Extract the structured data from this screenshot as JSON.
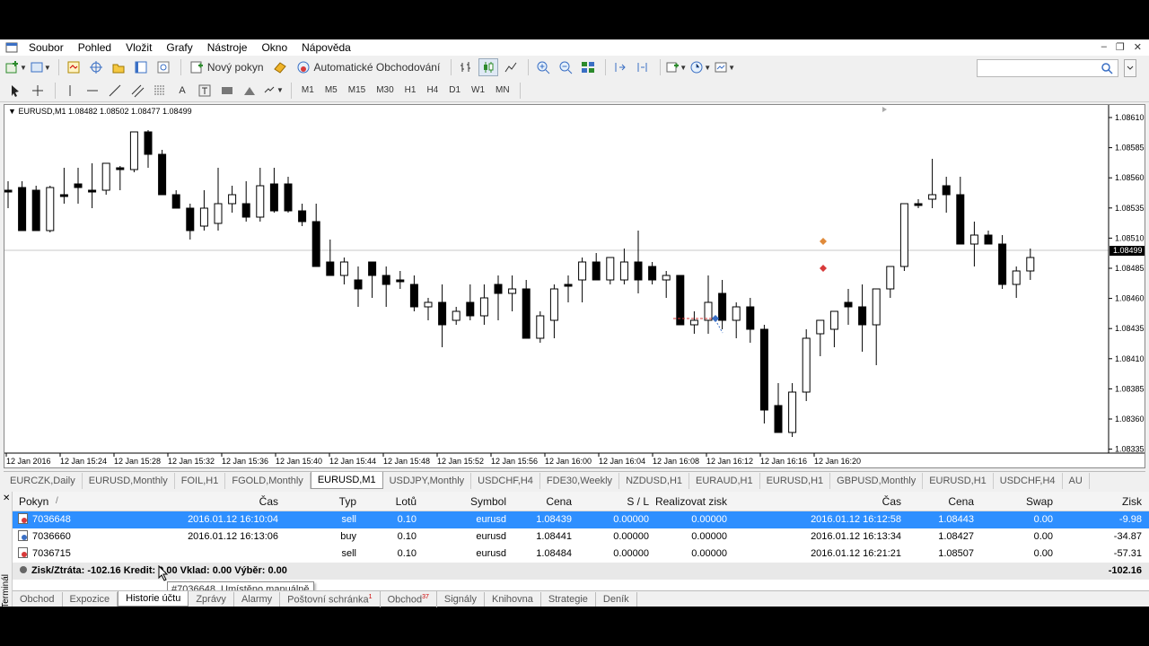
{
  "menu": [
    "Soubor",
    "Pohled",
    "Vložit",
    "Grafy",
    "Nástroje",
    "Okno",
    "Nápověda"
  ],
  "toolbar": {
    "new_order": "Nový pokyn",
    "auto_trading": "Automatické Obchodování"
  },
  "timeframes": [
    "M1",
    "M5",
    "M15",
    "M30",
    "H1",
    "H4",
    "D1",
    "W1",
    "MN"
  ],
  "chart": {
    "header": "EURUSD,M1  1.08482 1.08502 1.08477 1.08499",
    "current_price": "1.08499",
    "price_labels": [
      "1.08610",
      "1.08585",
      "1.08560",
      "1.08535",
      "1.08510",
      "1.08485",
      "1.08460",
      "1.08435",
      "1.08410",
      "1.08385",
      "1.08360",
      "1.08335"
    ],
    "time_labels": [
      "12 Jan 2016",
      "12 Jan 15:24",
      "12 Jan 15:28",
      "12 Jan 15:32",
      "12 Jan 15:36",
      "12 Jan 15:40",
      "12 Jan 15:44",
      "12 Jan 15:48",
      "12 Jan 15:52",
      "12 Jan 15:56",
      "12 Jan 16:00",
      "12 Jan 16:04",
      "12 Jan 16:08",
      "12 Jan 16:12",
      "12 Jan 16:16",
      "12 Jan 16:20"
    ]
  },
  "chart_tabs": [
    "EURCZK,Daily",
    "EURUSD,Monthly",
    "FOIL,H1",
    "FGOLD,Monthly",
    "EURUSD,M1",
    "USDJPY,Monthly",
    "USDCHF,H4",
    "FDE30,Weekly",
    "NZDUSD,H1",
    "EURAUD,H1",
    "EURUSD,H1",
    "GBPUSD,Monthly",
    "EURUSD,H1",
    "USDCHF,H4",
    "AU"
  ],
  "active_chart_tab": "EURUSD,M1",
  "terminal": {
    "label": "Terminál",
    "headers": {
      "order": "Pokyn",
      "sort_mark": "/",
      "time": "Čas",
      "type": "Typ",
      "lots": "Lotů",
      "symbol": "Symbol",
      "price": "Cena",
      "sl": "S / L",
      "realized": "Realizovat zisk",
      "time2": "Čas",
      "price2": "Cena",
      "swap": "Swap",
      "profit": "Zisk"
    },
    "rows": [
      {
        "order": "7036648",
        "time": "2016.01.12 16:10:04",
        "type": "sell",
        "lots": "0.10",
        "symbol": "eurusd",
        "price": "1.08439",
        "sl": "0.00000",
        "tp": "0.00000",
        "time2": "2016.01.12 16:12:58",
        "price2": "1.08443",
        "swap": "0.00",
        "profit": "-9.98"
      },
      {
        "order": "7036660",
        "time": "2016.01.12 16:13:06",
        "type": "buy",
        "lots": "0.10",
        "symbol": "eurusd",
        "price": "1.08441",
        "sl": "0.00000",
        "tp": "0.00000",
        "time2": "2016.01.12 16:13:34",
        "price2": "1.08427",
        "swap": "0.00",
        "profit": "-34.87"
      },
      {
        "order": "7036715",
        "time": "",
        "type": "sell",
        "lots": "0.10",
        "symbol": "eurusd",
        "price": "1.08484",
        "sl": "0.00000",
        "tp": "0.00000",
        "time2": "2016.01.12 16:21:21",
        "price2": "1.08507",
        "swap": "0.00",
        "profit": "-57.31"
      }
    ],
    "summary": "Zisk/Ztráta: -102.16  Kredit: 0.00  Vklad: 0.00  Výběr: 0.00",
    "summary_total": "-102.16",
    "tooltip": "#7036648, Umístěno manuálně",
    "tabs": [
      "Obchod",
      "Expozice",
      "Historie účtu",
      "Zprávy",
      "Alarmy",
      "Poštovní schránka",
      "Obchod",
      "Signály",
      "Knihovna",
      "Strategie",
      "Deník"
    ],
    "active_tab": "Historie účtu",
    "tab_badges": {
      "mail": "1",
      "market": "37"
    }
  },
  "colors": {
    "selection": "#2e8fff",
    "background": "#ffffff",
    "grid": "#f0f0f0"
  }
}
